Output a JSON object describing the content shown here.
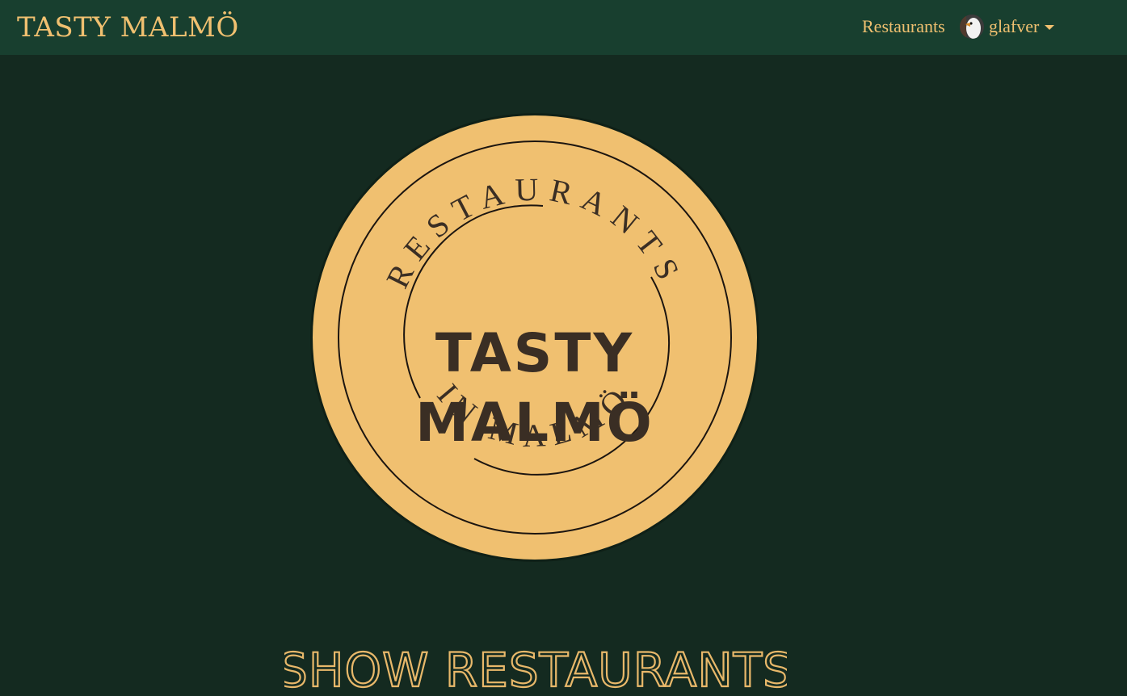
{
  "navbar": {
    "brand": "TASTY MALMÖ",
    "links": [
      {
        "label": "Restaurants"
      }
    ],
    "user": {
      "name": "glafver",
      "avatar_icon": "goose-avatar-icon"
    }
  },
  "logo": {
    "top_arc_text": "RESTAURANTS",
    "center_line1": "TASTY",
    "center_line2": "MALMÖ",
    "bottom_arc_text": "IN MALMÖ"
  },
  "cta": {
    "label": "SHOW RESTAURANTS"
  },
  "colors": {
    "navbar_bg": "#183f2f",
    "page_bg": "#142a20",
    "accent_gold": "#f0c070",
    "logo_text": "#3a2e24"
  }
}
